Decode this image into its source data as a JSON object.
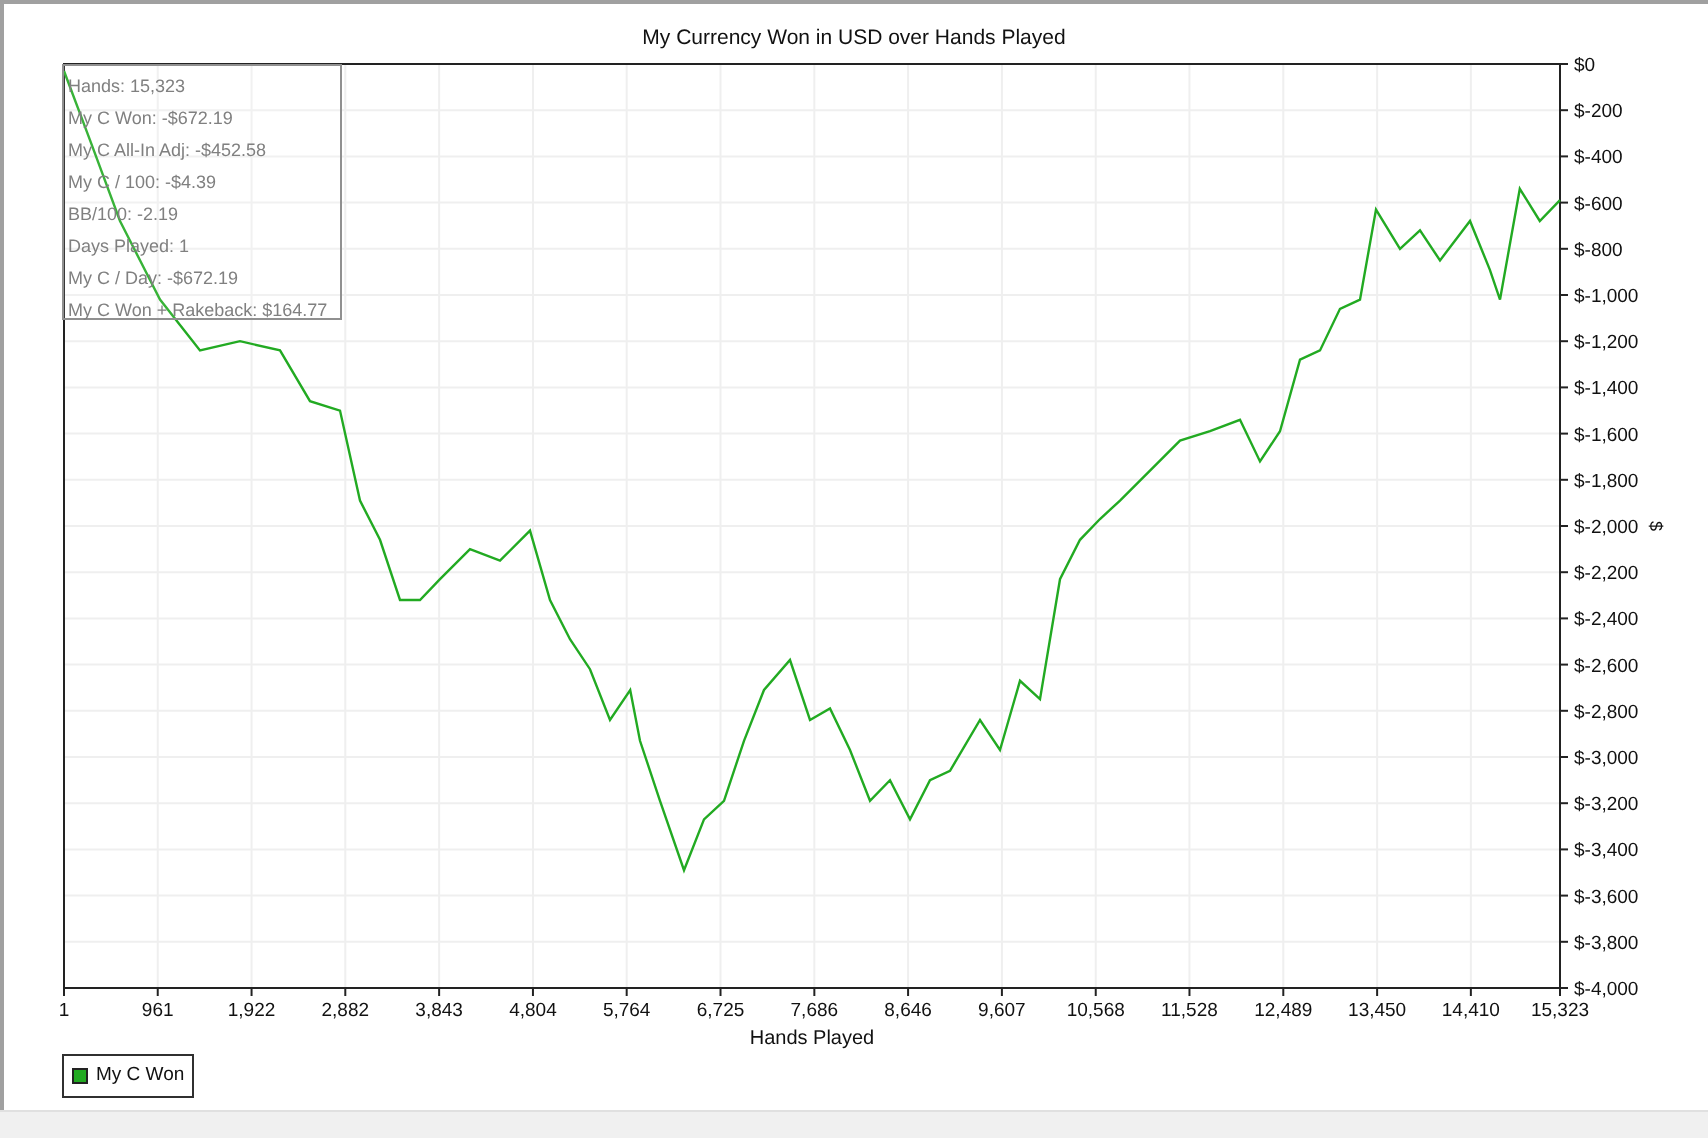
{
  "chart": {
    "chart_data": {
      "type": "line",
      "title": "My Currency Won in USD over Hands Played",
      "xlabel": "Hands Played",
      "ylabel": "$",
      "x": [
        1,
        267,
        574,
        984,
        1394,
        1804,
        2213,
        2520,
        2828,
        3033,
        3238,
        3442,
        3647,
        3852,
        4159,
        4466,
        4774,
        4979,
        5184,
        5389,
        5594,
        5799,
        5901,
        6106,
        6351,
        6556,
        6761,
        6966,
        7171,
        7437,
        7642,
        7847,
        8052,
        8257,
        8461,
        8666,
        8871,
        9076,
        9383,
        9588,
        9793,
        9997,
        10202,
        10407,
        10612,
        10817,
        11124,
        11431,
        11739,
        12046,
        12250,
        12455,
        12660,
        12865,
        13070,
        13275,
        13438,
        13684,
        13889,
        14094,
        14401,
        14605,
        14708,
        14912,
        15117,
        15323
      ],
      "series": [
        {
          "name": "My C Won",
          "color": "#22aa22",
          "values": [
            -30,
            -330,
            -680,
            -1020,
            -1240,
            -1200,
            -1240,
            -1460,
            -1500,
            -1890,
            -2060,
            -2320,
            -2320,
            -2230,
            -2100,
            -2150,
            -2020,
            -2320,
            -2490,
            -2620,
            -2840,
            -2710,
            -2930,
            -3190,
            -3490,
            -3270,
            -3190,
            -2930,
            -2710,
            -2580,
            -2840,
            -2790,
            -2970,
            -3190,
            -3100,
            -3270,
            -3100,
            -3060,
            -2840,
            -2970,
            -2670,
            -2750,
            -2230,
            -2060,
            -1970,
            -1890,
            -1760,
            -1630,
            -1590,
            -1540,
            -1720,
            -1590,
            -1280,
            -1240,
            -1060,
            -1020,
            -630,
            -800,
            -720,
            -850,
            -680,
            -890,
            -1020,
            -540,
            -680,
            -590
          ]
        }
      ],
      "grid": true,
      "xlim": [
        1,
        15323
      ],
      "ylim": [
        -4000,
        0
      ],
      "xticks": [
        {
          "value": 1,
          "label": "1"
        },
        {
          "value": 961,
          "label": "961"
        },
        {
          "value": 1922,
          "label": "1,922"
        },
        {
          "value": 2882,
          "label": "2,882"
        },
        {
          "value": 3843,
          "label": "3,843"
        },
        {
          "value": 4804,
          "label": "4,804"
        },
        {
          "value": 5764,
          "label": "5,764"
        },
        {
          "value": 6725,
          "label": "6,725"
        },
        {
          "value": 7686,
          "label": "7,686"
        },
        {
          "value": 8646,
          "label": "8,646"
        },
        {
          "value": 9607,
          "label": "9,607"
        },
        {
          "value": 10568,
          "label": "10,568"
        },
        {
          "value": 11528,
          "label": "11,528"
        },
        {
          "value": 12489,
          "label": "12,489"
        },
        {
          "value": 13450,
          "label": "13,450"
        },
        {
          "value": 14410,
          "label": "14,410"
        },
        {
          "value": 15323,
          "label": "15,323"
        }
      ],
      "yticks": [
        {
          "value": 0,
          "label": "$0"
        },
        {
          "value": -200,
          "label": "$-200"
        },
        {
          "value": -400,
          "label": "$-400"
        },
        {
          "value": -600,
          "label": "$-600"
        },
        {
          "value": -800,
          "label": "$-800"
        },
        {
          "value": -1000,
          "label": "$-1,000"
        },
        {
          "value": -1200,
          "label": "$-1,200"
        },
        {
          "value": -1400,
          "label": "$-1,400"
        },
        {
          "value": -1600,
          "label": "$-1,600"
        },
        {
          "value": -1800,
          "label": "$-1,800"
        },
        {
          "value": -2000,
          "label": "$-2,000"
        },
        {
          "value": -2200,
          "label": "$-2,200"
        },
        {
          "value": -2400,
          "label": "$-2,400"
        },
        {
          "value": -2600,
          "label": "$-2,600"
        },
        {
          "value": -2800,
          "label": "$-2,800"
        },
        {
          "value": -3000,
          "label": "$-3,000"
        },
        {
          "value": -3200,
          "label": "$-3,200"
        },
        {
          "value": -3400,
          "label": "$-3,400"
        },
        {
          "value": -3600,
          "label": "$-3,600"
        },
        {
          "value": -3800,
          "label": "$-3,800"
        },
        {
          "value": -4000,
          "label": "$-4,000"
        }
      ]
    }
  },
  "stats": [
    "Hands: 15,323",
    "My C Won: -$672.19",
    "My C All-In Adj: -$452.58",
    "My C / 100: -$4.39",
    "BB/100: -2.19",
    "Days Played: 1",
    "My C / Day: -$672.19",
    "My C Won + Rakeback: $164.77"
  ]
}
